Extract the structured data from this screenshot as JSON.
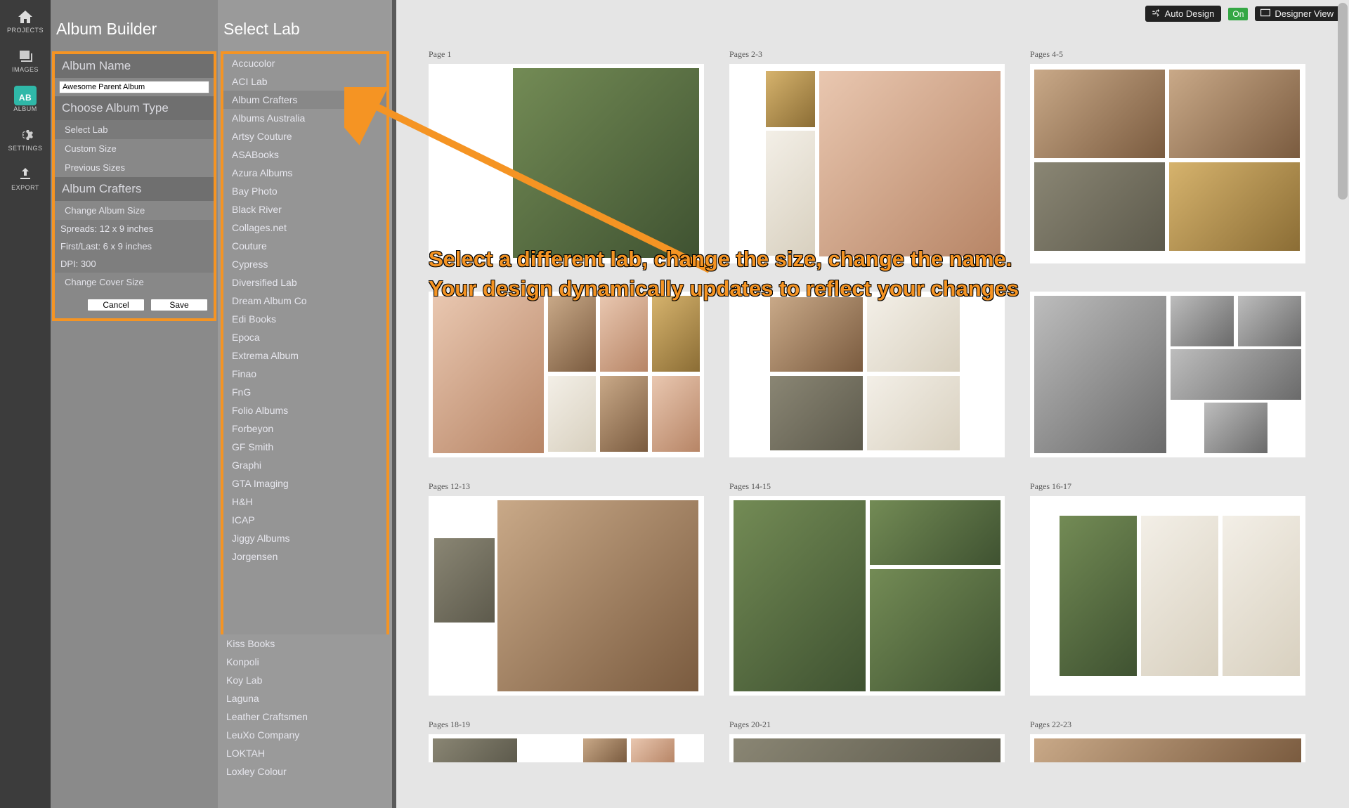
{
  "nav": {
    "projects": "PROJECTS",
    "images": "IMAGES",
    "album": "ALBUM",
    "album_badge": "AB",
    "settings": "SETTINGS",
    "export": "EXPORT"
  },
  "panel1": {
    "title": "Album Builder",
    "album_name_label": "Album Name",
    "album_name_value": "Awesome Parent Album",
    "choose_type_label": "Choose Album Type",
    "type_options": [
      "Select Lab",
      "Custom Size",
      "Previous Sizes"
    ],
    "crafters_label": "Album Crafters",
    "crafters_options": [
      "Change Album Size"
    ],
    "info_spreads": "Spreads: 12 x 9 inches",
    "info_firstlast": "First/Last: 6 x 9 inches",
    "info_dpi": "DPI: 300",
    "cover_option": "Change Cover Size",
    "btn_cancel": "Cancel",
    "btn_save": "Save"
  },
  "panel2": {
    "title": "Select Lab",
    "labs": [
      "Accucolor",
      "ACI Lab",
      "Album Crafters",
      "Albums Australia",
      "Artsy Couture",
      "ASABooks",
      "Azura Albums",
      "Bay Photo",
      "Black River",
      "Collages.net",
      "Couture",
      "Cypress",
      "Diversified Lab",
      "Dream Album Co",
      "Edi Books",
      "Epoca",
      "Extrema Album",
      "Finao",
      "FnG",
      "Folio Albums",
      "Forbeyon",
      "GF Smith",
      "Graphi",
      "GTA Imaging",
      "H&H",
      "ICAP",
      "Jiggy Albums",
      "Jorgensen",
      "Kiss Books",
      "Konpoli",
      "Koy Lab",
      "Laguna",
      "Leather Craftsmen",
      "LeuXo Company",
      "LOKTAH",
      "Loxley Colour"
    ],
    "highlight_index": 2
  },
  "topbar": {
    "auto_design": "Auto Design",
    "on": "On",
    "designer_view": "Designer View"
  },
  "canvas": {
    "rows": [
      [
        {
          "label": "Page 1",
          "kind": "single"
        },
        {
          "label": "Pages 2-3",
          "kind": "dbl"
        },
        {
          "label": "Pages 4-5",
          "kind": "dbl"
        }
      ],
      [
        {
          "label": "",
          "kind": "short"
        },
        {
          "label": "",
          "kind": "short"
        },
        {
          "label": "",
          "kind": "short"
        }
      ],
      [
        {
          "label": "Pages 12-13",
          "kind": "dbl"
        },
        {
          "label": "Pages 14-15",
          "kind": "dbl"
        },
        {
          "label": "Pages 16-17",
          "kind": "dbl"
        }
      ],
      [
        {
          "label": "Pages 18-19",
          "kind": "cut"
        },
        {
          "label": "Pages 20-21",
          "kind": "cut"
        },
        {
          "label": "Pages 22-23",
          "kind": "cut"
        }
      ]
    ]
  },
  "annotation": {
    "line1": "Select a different lab, change the size, change the name.",
    "line2": "Your design dynamically updates to reflect your changes"
  }
}
